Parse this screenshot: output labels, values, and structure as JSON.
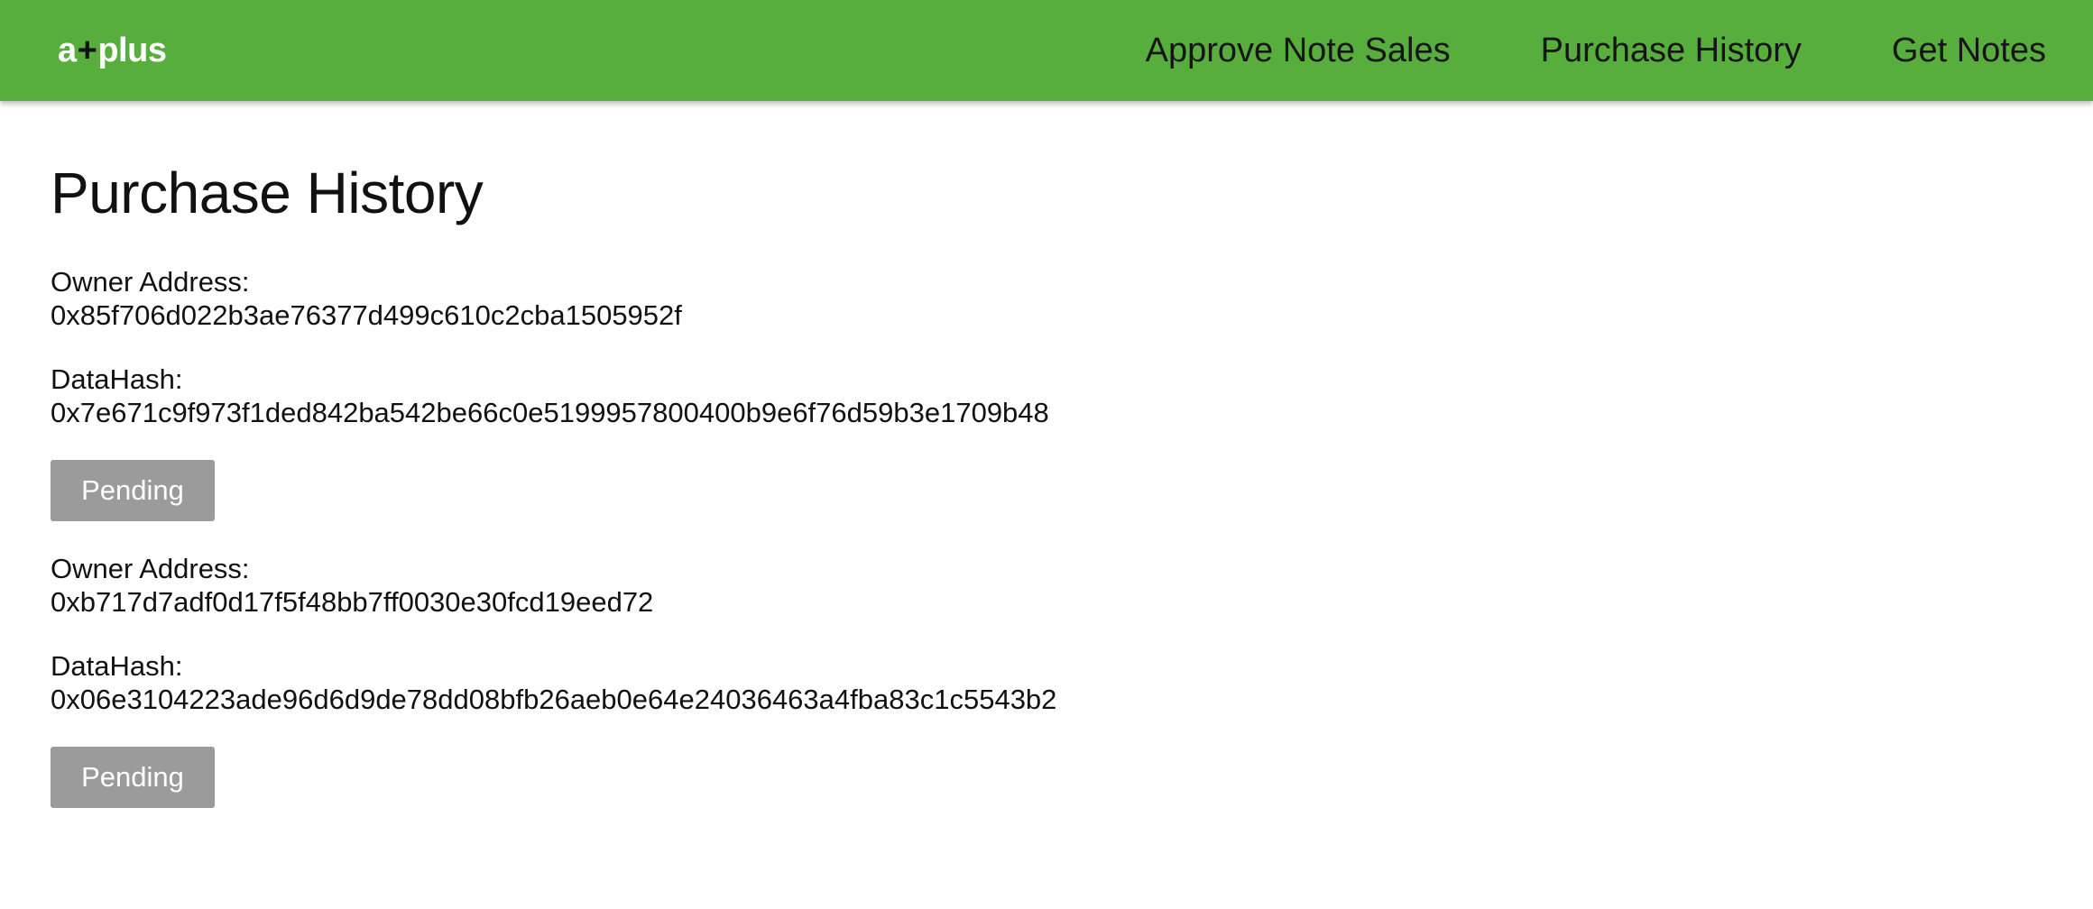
{
  "header": {
    "logo": {
      "prefix": "a",
      "symbol": "+",
      "suffix": "plus"
    },
    "nav": [
      {
        "label": "Approve Note Sales"
      },
      {
        "label": "Purchase History"
      },
      {
        "label": "Get Notes"
      }
    ]
  },
  "main": {
    "title": "Purchase History",
    "records": [
      {
        "owner_label": "Owner Address:",
        "owner_value": "0x85f706d022b3ae76377d499c610c2cba1505952f",
        "hash_label": "DataHash:",
        "hash_value": "0x7e671c9f973f1ded842ba542be66c0e5199957800400b9e6f76d59b3e1709b48",
        "status": "Pending"
      },
      {
        "owner_label": "Owner Address:",
        "owner_value": "0xb717d7adf0d17f5f48bb7ff0030e30fcd19eed72",
        "hash_label": "DataHash:",
        "hash_value": "0x06e3104223ade96d6d9de78dd08bfb26aeb0e64e24036463a4fba83c1c5543b2",
        "status": "Pending"
      }
    ]
  },
  "colors": {
    "header_background": "#58ae3c",
    "button_background": "#9b9b9b",
    "text": "#111111"
  }
}
